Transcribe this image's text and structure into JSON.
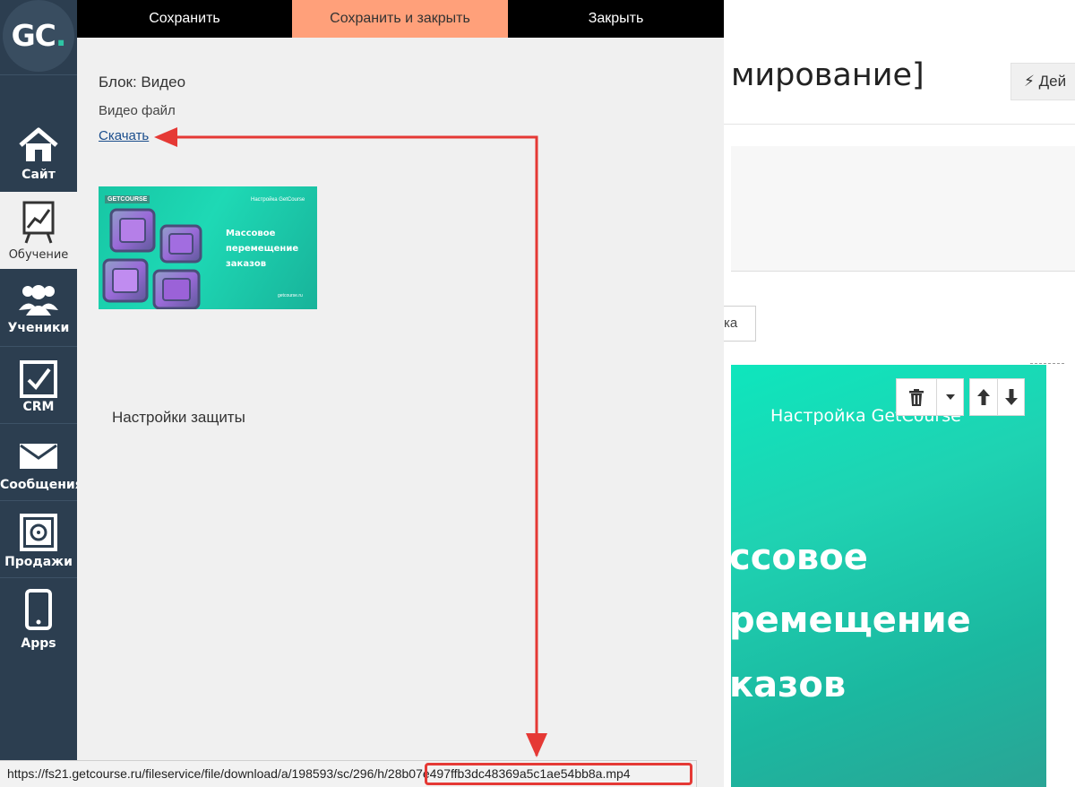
{
  "sidebar": {
    "logo": "GC",
    "logo_dot": ".",
    "items": [
      {
        "label": "Сайт",
        "icon": "home-icon"
      },
      {
        "label": "Обучение",
        "icon": "training-chart-icon"
      },
      {
        "label": "Ученики",
        "icon": "users-icon"
      },
      {
        "label": "CRM",
        "icon": "checkbox-icon"
      },
      {
        "label": "Сообщения",
        "icon": "envelope-icon"
      },
      {
        "label": "Продажи",
        "icon": "safe-icon"
      },
      {
        "label": "Apps",
        "icon": "phone-icon"
      }
    ],
    "active_item": "Обучение"
  },
  "toolbar": {
    "save_label": "Сохранить",
    "save_close_label": "Сохранить и закрыть",
    "close_label": "Закрыть"
  },
  "editor": {
    "block_title": "Блок: Видео",
    "video_label": "Видео файл",
    "download_label": "Скачать",
    "thumbnail": {
      "brand": "GETCOURSE",
      "tag": "Настройка GetCourse",
      "title": "Массовое перемещение заказов",
      "footer": "getcourse.ru"
    },
    "security_title": "Настройки защиты"
  },
  "background_page": {
    "heading_fragment": "мирование]",
    "actions_label": "⚡ Дей",
    "small_button_fragment": "ка",
    "preview": {
      "subtitle": "Настройка GetCourse",
      "line1": "ссовое",
      "line2": "ремещение",
      "line3": "казов"
    }
  },
  "status_bar": {
    "url": "https://fs21.getcourse.ru/fileservice/file/download/a/198593/sc/296/h/28b07e497ffb3dc48369a5c1ae54bb8a.mp4"
  },
  "colors": {
    "sidebar_bg": "#2c3e50",
    "accent_orange": "#ffa07a",
    "panel_bg": "#f0f0f0",
    "annotation_red": "#e53935",
    "link_blue": "#1a4d8c",
    "teal": "#1ed9b5"
  }
}
